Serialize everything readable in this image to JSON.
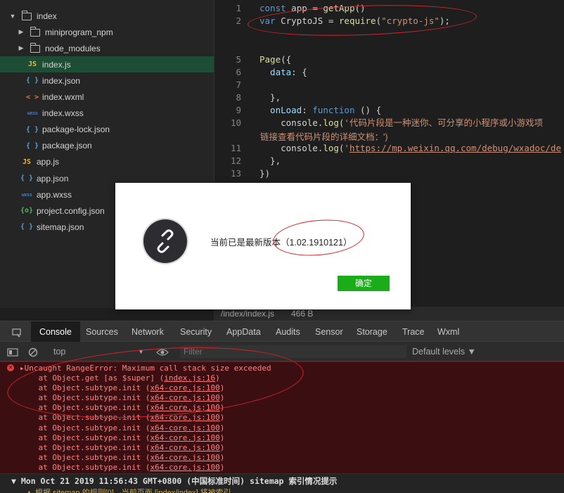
{
  "file_tree": {
    "items": [
      {
        "label": "index",
        "kind": "folder",
        "caret": "▼",
        "depth": 0
      },
      {
        "label": "miniprogram_npm",
        "kind": "folder",
        "caret": "▶",
        "depth": 1
      },
      {
        "label": "node_modules",
        "kind": "folder",
        "caret": "▶",
        "depth": 1
      },
      {
        "label": "index.js",
        "kind": "js",
        "icon": "JS",
        "depth": 1,
        "active": true
      },
      {
        "label": "index.json",
        "kind": "json",
        "icon": "{ }",
        "depth": 1
      },
      {
        "label": "index.wxml",
        "kind": "wxml",
        "icon": "< >",
        "depth": 1
      },
      {
        "label": "index.wxss",
        "kind": "wxss",
        "icon": "wxss",
        "depth": 1
      },
      {
        "label": "package-lock.json",
        "kind": "json",
        "icon": "{ }",
        "depth": 1
      },
      {
        "label": "package.json",
        "kind": "json",
        "icon": "{ }",
        "depth": 1
      },
      {
        "label": "app.js",
        "kind": "js",
        "icon": "JS",
        "depth": 0
      },
      {
        "label": "app.json",
        "kind": "json",
        "icon": "{ }",
        "depth": 0
      },
      {
        "label": "app.wxss",
        "kind": "wxss",
        "icon": "wxss",
        "depth": 0
      },
      {
        "label": "project.config.json",
        "kind": "cfg",
        "icon": "{o}",
        "depth": 0
      },
      {
        "label": "sitemap.json",
        "kind": "json",
        "icon": "{ }",
        "depth": 0
      }
    ]
  },
  "editor": {
    "lines": [
      {
        "num": "1",
        "tokens": [
          [
            "kw",
            "const"
          ],
          [
            "id",
            " app = "
          ],
          [
            "fn",
            "getApp"
          ],
          [
            "id",
            "()"
          ]
        ]
      },
      {
        "num": "2",
        "tokens": [
          [
            "kw",
            "var"
          ],
          [
            "id",
            " CryptoJS = "
          ],
          [
            "fn",
            "require"
          ],
          [
            "id",
            "("
          ],
          [
            "str",
            "\"crypto-js\""
          ],
          [
            "id",
            ");"
          ]
        ]
      },
      {
        "num": "",
        "tokens": []
      },
      {
        "num": "",
        "tokens": []
      },
      {
        "num": "5",
        "tokens": [
          [
            "fn",
            "Page"
          ],
          [
            "id",
            "({"
          ]
        ]
      },
      {
        "num": "6",
        "tokens": [
          [
            "prop",
            "  data"
          ],
          [
            "id",
            ": {"
          ]
        ]
      },
      {
        "num": "7",
        "tokens": []
      },
      {
        "num": "8",
        "tokens": [
          [
            "id",
            "  },"
          ]
        ]
      },
      {
        "num": "9",
        "tokens": [
          [
            "prop",
            "  onLoad"
          ],
          [
            "id",
            ": "
          ],
          [
            "kw",
            "function"
          ],
          [
            "id",
            " () {"
          ]
        ]
      },
      {
        "num": "10",
        "tokens": [
          [
            "id",
            "    console."
          ],
          [
            "fn",
            "log"
          ],
          [
            "id",
            "("
          ],
          [
            "str",
            "'代码片段是一种迷你、可分享的小程序或小游戏项"
          ]
        ]
      },
      {
        "num": "11",
        "tokens": [
          [
            "id",
            "    console."
          ],
          [
            "fn",
            "log"
          ],
          [
            "id",
            "("
          ],
          [
            "str",
            "'"
          ],
          [
            "link",
            "https://mp.weixin.qq.com/debug/wxadoc/de"
          ]
        ]
      },
      {
        "num": "12",
        "tokens": [
          [
            "id",
            "  },"
          ]
        ]
      },
      {
        "num": "13",
        "tokens": [
          [
            "id",
            "})"
          ]
        ]
      }
    ],
    "wrapped_text": "链接查看代码片段的详细文档：')"
  },
  "file_bar": {
    "path": "/index/index.js",
    "size": "466 B"
  },
  "dialog": {
    "message": "当前已是最新版本（1.02.1910121）",
    "ok_label": "确定"
  },
  "devtools": {
    "tabs": [
      "Console",
      "Sources",
      "Network",
      "Security",
      "AppData",
      "Audits",
      "Sensor",
      "Storage",
      "Trace",
      "Wxml"
    ],
    "active_tab": "Console",
    "context": "top",
    "filter_placeholder": "Filter",
    "levels": "Default levels ▼",
    "error": {
      "message": "▸Uncaught RangeError: Maximum call stack size exceeded",
      "stack": [
        {
          "text": "    at Object.get [as $super] (",
          "src": "index.js:16",
          "end": ")"
        },
        {
          "text": "    at Object.subtype.init (",
          "src": "x64-core.js:100",
          "end": ")"
        },
        {
          "text": "    at Object.subtype.init (",
          "src": "x64-core.js:100",
          "end": ")"
        },
        {
          "text": "    at Object.subtype.init (",
          "src": "x64-core.js:100",
          "end": ")"
        },
        {
          "text": "    at Object.subtype.init (",
          "src": "x64-core.js:100",
          "end": ")"
        },
        {
          "text": "    at Object.subtype.init (",
          "src": "x64-core.js:100",
          "end": ")"
        },
        {
          "text": "    at Object.subtype.init (",
          "src": "x64-core.js:100",
          "end": ")"
        },
        {
          "text": "    at Object.subtype.init (",
          "src": "x64-core.js:100",
          "end": ")"
        },
        {
          "text": "    at Object.subtype.init (",
          "src": "x64-core.js:100",
          "end": ")"
        },
        {
          "text": "    at Object.subtype.init (",
          "src": "x64-core.js:100",
          "end": ")"
        }
      ]
    },
    "group_line": "▼ Mon Oct 21 2019 11:56:43 GMT+0800 (中国标准时间) sitemap 索引情况提示",
    "cut_line": "▲  根据 sitemap 的规则[0]，当前页面 [index/index] 将被索引"
  },
  "colors": {
    "accent_green": "#1aad19",
    "annotation_red": "#d4242a",
    "active_file_bg": "#1e4d36"
  }
}
